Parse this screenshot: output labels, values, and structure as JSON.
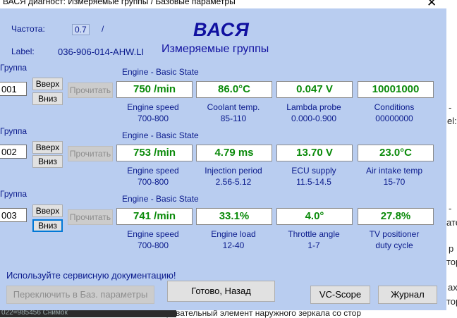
{
  "window": {
    "title": "ВАСЯ диагност: Измеряемые группы / Базовые параметры",
    "close_symbol": "✕"
  },
  "header": {
    "freq_label": "Частота:",
    "freq_value": "0.7",
    "freq_slash": "/",
    "label_caption": "Label:",
    "label_value": "036-906-014-AHW.LI",
    "logo": "ВАСЯ",
    "subtitle": "Измеряемые группы"
  },
  "groups": [
    {
      "group_label": "Группа",
      "number": "001",
      "up_label": "Вверх",
      "down_label": "Вниз",
      "read_label": "Прочитать",
      "state": "Engine - Basic State",
      "fields": [
        {
          "value": "750 /min",
          "name": "Engine speed",
          "range": "700-800"
        },
        {
          "value": "86.0°C",
          "name": "Coolant temp.",
          "range": "85-110"
        },
        {
          "value": "0.047 V",
          "name": "Lambda probe",
          "range": "0.000-0.900"
        },
        {
          "value": "10001000",
          "name": "Conditions",
          "range": "00000000"
        }
      ]
    },
    {
      "group_label": "Группа",
      "number": "002",
      "up_label": "Вверх",
      "down_label": "Вниз",
      "read_label": "Прочитать",
      "state": "Engine - Basic State",
      "fields": [
        {
          "value": "753 /min",
          "name": "Engine speed",
          "range": "700-800"
        },
        {
          "value": "4.79 ms",
          "name": "Injection period",
          "range": "2.56-5.12"
        },
        {
          "value": "13.70 V",
          "name": "ECU supply",
          "range": "11.5-14.5"
        },
        {
          "value": "23.0°C",
          "name": "Air intake temp",
          "range": "15-70"
        }
      ]
    },
    {
      "group_label": "Группа",
      "number": "003",
      "up_label": "Вверх",
      "down_label": "Вниз",
      "read_label": "Прочитать",
      "state": "Engine - Basic State",
      "fields": [
        {
          "value": "741 /min",
          "name": "Engine speed",
          "range": "700-800"
        },
        {
          "value": "33.1%",
          "name": "Engine load",
          "range": "12-40"
        },
        {
          "value": "4.0°",
          "name": "Throttle angle",
          "range": "1-7"
        },
        {
          "value": "27.8%",
          "name": "TV positioner",
          "range": "duty cycle"
        }
      ]
    }
  ],
  "footer": {
    "note": "Используйте сервисную документацию!",
    "switch_label": "Переключить в Баз. параметры",
    "done_label": "Готово, Назад",
    "vcscope_label": "VC-Scope",
    "journal_label": "Журнал"
  },
  "background": {
    "line1": "-",
    "line2": "el:",
    "line3": "-",
    "line4": "ате",
    "line5": "р",
    "line6": "тор",
    "line7": "ах",
    "line8": "тор",
    "bottom_line": "0094    нагревательный элемент наружного зеркала со стор",
    "bottom_left": "022=985456   Снимок"
  }
}
